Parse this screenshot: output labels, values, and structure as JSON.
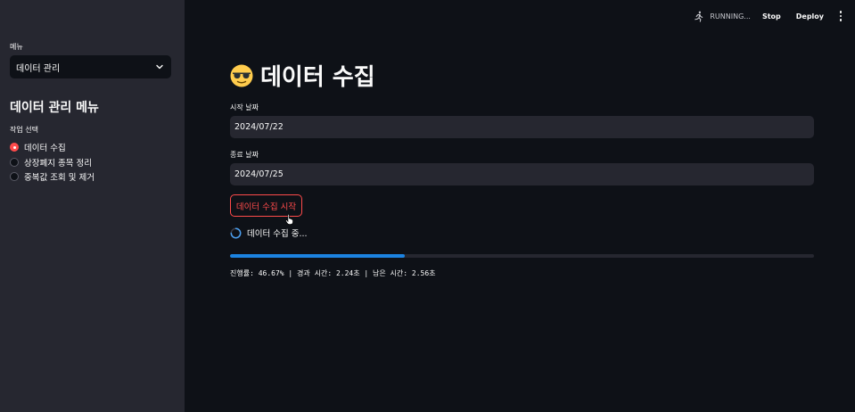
{
  "sidebar": {
    "menu_label": "메뉴",
    "menu_selected": "데이터 관리",
    "title": "데이터 관리 메뉴",
    "radio_label": "작업 선택",
    "radio_options": [
      {
        "label": "데이터 수집",
        "checked": true
      },
      {
        "label": "상장폐지 종목 정리",
        "checked": false
      },
      {
        "label": "중복값 조회 및 제거",
        "checked": false
      }
    ]
  },
  "header": {
    "status": "RUNNING...",
    "stop_label": "Stop",
    "deploy_label": "Deploy",
    "running_icon": "running-man-icon",
    "menu_icon": "kebab-menu-icon"
  },
  "main": {
    "title_emoji": "smiling-face-with-sunglasses",
    "title": "데이터 수집",
    "start_date_label": "시작 날짜",
    "start_date_value": "2024/07/22",
    "end_date_label": "종료 날짜",
    "end_date_value": "2024/07/25",
    "start_button_label": "데이터 수집 시작",
    "spinner_text": "데이터 수집 중...",
    "progress_fraction": 0.2985,
    "progress_text": "진행률: 46.67% | 경과 시간: 2.24초 | 남은 시간: 2.56초"
  },
  "colors": {
    "background": "#0e1117",
    "sidebar": "#262730",
    "accent": "#ff4b4b",
    "progress": "#1c83e1",
    "text": "#fafafa"
  }
}
